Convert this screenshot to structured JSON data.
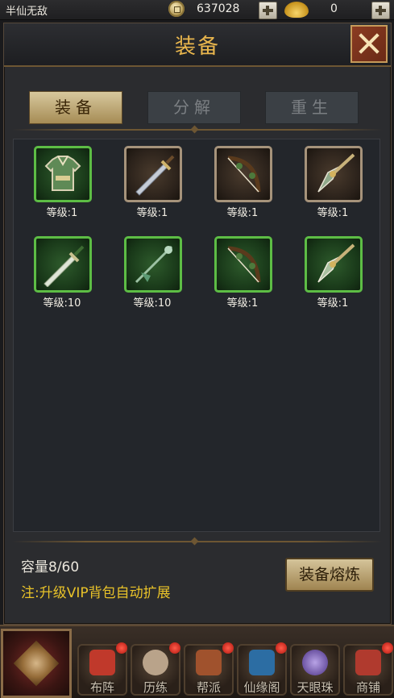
{
  "topbar": {
    "player_name": "半仙无敌",
    "copper_value": "637028",
    "ingot_value": "0"
  },
  "window": {
    "title": "装备",
    "tabs": [
      {
        "label": "装备",
        "active": true
      },
      {
        "label": "分解",
        "active": false
      },
      {
        "label": "重生",
        "active": false
      }
    ]
  },
  "items": [
    {
      "name": "armor",
      "level": "等级:1",
      "frame": "green"
    },
    {
      "name": "sword",
      "level": "等级:1",
      "frame": "brown"
    },
    {
      "name": "bow",
      "level": "等级:1",
      "frame": "brown"
    },
    {
      "name": "spear",
      "level": "等级:1",
      "frame": "brown"
    },
    {
      "name": "sword",
      "level": "等级:10",
      "frame": "green"
    },
    {
      "name": "staff",
      "level": "等级:10",
      "frame": "green"
    },
    {
      "name": "bow",
      "level": "等级:1",
      "frame": "green"
    },
    {
      "name": "spear",
      "level": "等级:1",
      "frame": "green"
    }
  ],
  "footer": {
    "capacity": "容量8/60",
    "vip_note": "注:升级VIP背包自动扩展",
    "smelt_button": "装备熔炼"
  },
  "bottom_nav": [
    {
      "label": "布阵",
      "icon": "formation-icon",
      "color": "#c0392b"
    },
    {
      "label": "历练",
      "icon": "gourd-icon",
      "color": "#b9a38a"
    },
    {
      "label": "帮派",
      "icon": "banner-icon",
      "color": "#a0522d"
    },
    {
      "label": "仙缘阁",
      "icon": "pavilion-icon",
      "color": "#2c6da3"
    },
    {
      "label": "天眼珠",
      "icon": "orb-icon",
      "color": "#6a4da3"
    },
    {
      "label": "商铺",
      "icon": "shop-icon",
      "color": "#b03a2e"
    }
  ]
}
